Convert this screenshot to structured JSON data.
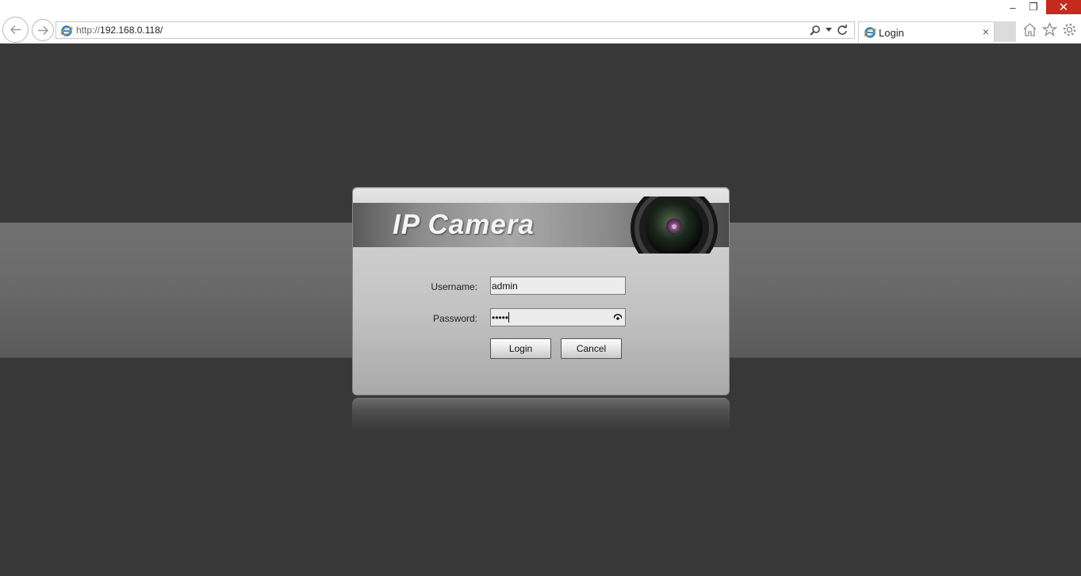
{
  "browser": {
    "address": {
      "url_prefix": "http://",
      "url_host": "192.168.0.118/"
    },
    "tab": {
      "title": "Login",
      "close": "×"
    },
    "window": {
      "min": "–",
      "max": "❐",
      "close": "✕"
    },
    "icons": [
      "back-icon",
      "forward-icon",
      "ie-icon",
      "search-icon",
      "dropdown-icon",
      "refresh-icon",
      "home-icon",
      "favorites-star-icon",
      "settings-gear-icon"
    ]
  },
  "login": {
    "banner_title": "IP Camera",
    "username_label": "Username:",
    "username_value": "admin",
    "password_label": "Password:",
    "password_value": "•••••",
    "login_button": "Login",
    "cancel_button": "Cancel"
  },
  "colors": {
    "background": "#383838",
    "band": "#6a6a6a",
    "close_button": "#c42b1c"
  }
}
